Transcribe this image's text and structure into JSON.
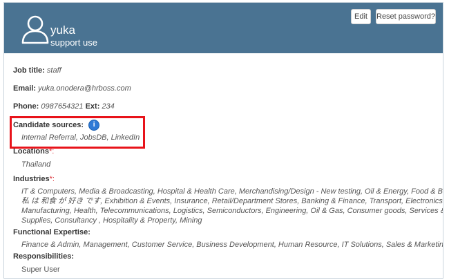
{
  "profile": {
    "name": "yuka",
    "role": "support use"
  },
  "actions": {
    "edit_label": "Edit",
    "reset_label": "Reset password?"
  },
  "fields": {
    "job_title_label": "Job title:",
    "job_title_value": "staff",
    "email_label": "Email:",
    "email_value": "yuka.onodera@hrboss.com",
    "phone_label": "Phone:",
    "phone_value": "0987654321",
    "ext_label": "Ext:",
    "ext_value": "234",
    "candidate_sources_label": "Candidate sources:",
    "candidate_sources_value": "Internal Referral, JobsDB, LinkedIn",
    "locations_label": "Locations",
    "locations_value": "Thailand",
    "industries_label": "Industries",
    "industries_line1": "IT & Computers, Media & Broadcasting, Hospital & Health Care, Merchandising/Design - New testing, Oil & Energy, Food & Beverages",
    "industries_line2": "私 は 和食 が 好き です, Exhibition & Events, Insurance, Retail/Department Stores, Banking & Finance, Transport, Electronics &",
    "industries_line3": "Manufacturing, Health, Telecommunications, Logistics, Semiconductors, Engineering, Oil & Gas, Consumer goods, Services &",
    "industries_line4": "Supplies, Consultancy , Hospitality & Property, Mining",
    "functional_label": "Functional Expertise:",
    "functional_value": "Finance & Admin, Management, Customer Service, Business Development, Human Resource, IT Solutions, Sales & Marketing",
    "responsibilities_label": "Responsibilities:",
    "responsibilities_value": "Super User",
    "required_marker": "*:"
  },
  "icons": {
    "avatar": "user-outline-icon",
    "info": "info-icon",
    "info_glyph": "i"
  },
  "colors": {
    "header_bg": "#4a7392",
    "highlight": "#e8131a",
    "info": "#2f7ad6",
    "required": "#d9282f"
  }
}
